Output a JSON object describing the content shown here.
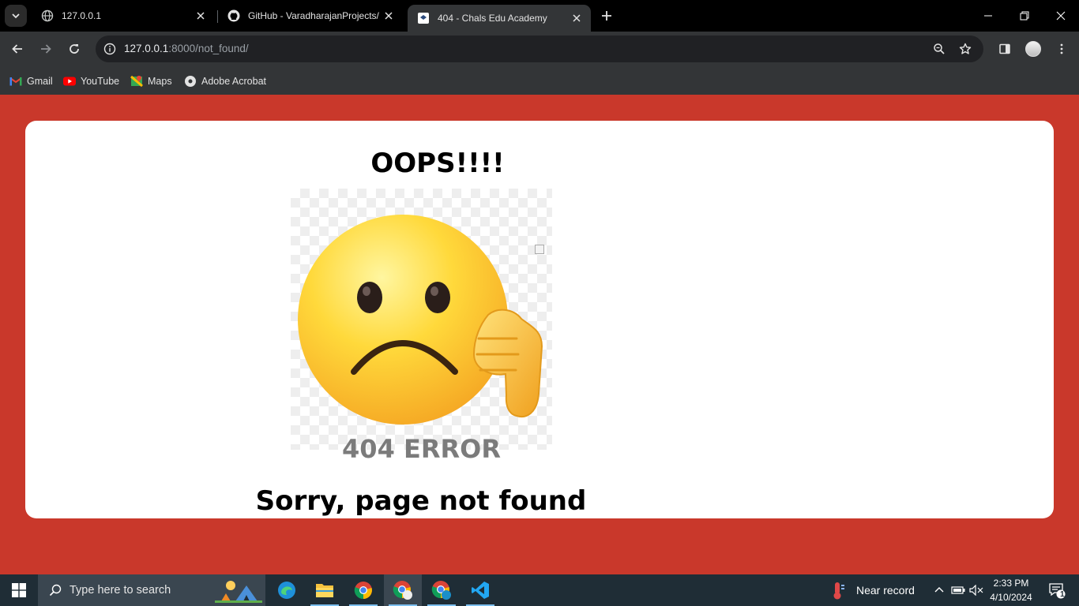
{
  "tabs": [
    {
      "title": "127.0.0.1",
      "icon": "globe-icon",
      "active": false
    },
    {
      "title": "GitHub - VaradharajanProjects/",
      "icon": "github-icon",
      "active": false
    },
    {
      "title": "404 - Chals Edu Academy",
      "icon": "site-favicon-icon",
      "active": true
    }
  ],
  "address": {
    "host": "127.0.0.1",
    "path": ":8000/not_found/"
  },
  "bookmarks": [
    {
      "label": "Gmail",
      "icon": "gmail-icon"
    },
    {
      "label": "YouTube",
      "icon": "youtube-icon"
    },
    {
      "label": "Maps",
      "icon": "maps-icon"
    },
    {
      "label": "Adobe Acrobat",
      "icon": "acrobat-icon"
    }
  ],
  "page": {
    "heading": "OOPS!!!!",
    "error_text": "404 ERROR",
    "message": "Sorry, page not found",
    "background_color": "#c9382b",
    "card_color": "#ffffff"
  },
  "taskbar": {
    "search_placeholder": "Type here to search",
    "apps": [
      "edge-icon",
      "file-explorer-icon",
      "chrome-icon",
      "chrome-profile-icon",
      "chrome-canary-icon",
      "vscode-icon"
    ],
    "weather": "Near record",
    "time": "2:33 PM",
    "date": "4/10/2024",
    "notification_count": "1"
  }
}
